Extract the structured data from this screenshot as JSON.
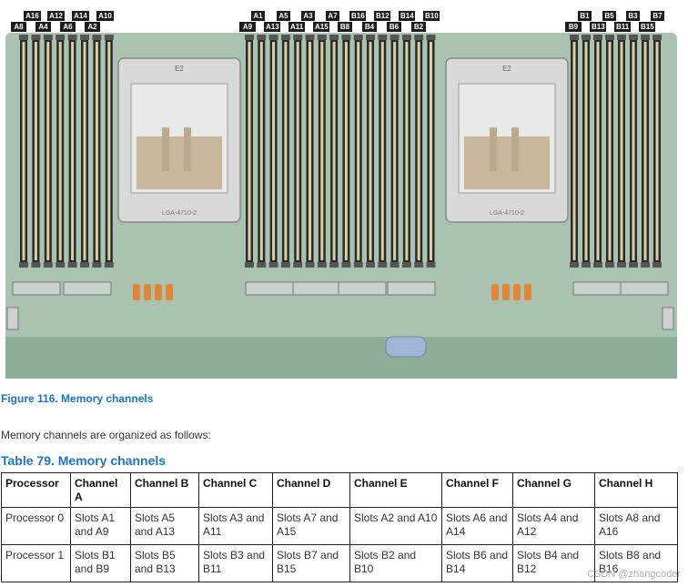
{
  "figure": {
    "caption": "Figure 116. Memory channels",
    "slot_labels_left": [
      "A16",
      "A12",
      "A14",
      "A10",
      "A8",
      "A4",
      "A6",
      "A2"
    ],
    "slot_labels_mid_top": [
      "A1",
      "A5",
      "A3",
      "A7",
      "B16",
      "B12",
      "B14",
      "B10"
    ],
    "slot_labels_mid_bottom": [
      "A9",
      "A13",
      "A11",
      "A15",
      "B8",
      "B4",
      "B6",
      "B2"
    ],
    "slot_labels_right_top": [
      "B1",
      "B5",
      "B3",
      "B7"
    ],
    "slot_labels_right_bottom": [
      "B9",
      "B13",
      "B11",
      "B15"
    ],
    "socket_labels": [
      "E2",
      "E2"
    ],
    "socket_markings": [
      "LGA-4710-2",
      "LGA-4710-2"
    ],
    "colors": {
      "board": "#a9c3b0",
      "board_dark": "#8fae98",
      "dimm_slot": "#2a2a2a",
      "dimm_gap": "#d8cfa4",
      "socket_frame": "#d9d9d9",
      "socket_pad": "#c8b79b",
      "capacitor": "#e0883a",
      "handle": "#9fb6d6",
      "label_bg": "#1c1c1c"
    }
  },
  "intro_text": "Memory channels are organized as follows:",
  "table": {
    "title": "Table 79. Memory channels",
    "headers": [
      "Processor",
      "Channel A",
      "Channel B",
      "Channel C",
      "Channel D",
      "Channel E",
      "Channel F",
      "Channel G",
      "Channel H"
    ],
    "rows": [
      [
        "Processor 0",
        "Slots A1 and A9",
        "Slots A5 and A13",
        "Slots A3 and A11",
        "Slots A7 and A15",
        "Slots A2 and A10",
        "Slots A6 and A14",
        "Slots A4 and A12",
        "Slots A8 and A16"
      ],
      [
        "Processor 1",
        "Slots B1 and B9",
        "Slots B5 and B13",
        "Slots B3 and B11",
        "Slots B7 and B15",
        "Slots B2 and B10",
        "Slots B6 and B14",
        "Slots B4 and B12",
        "Slots B8 and B16"
      ]
    ]
  },
  "watermark": "CSDN @zhangcoder"
}
